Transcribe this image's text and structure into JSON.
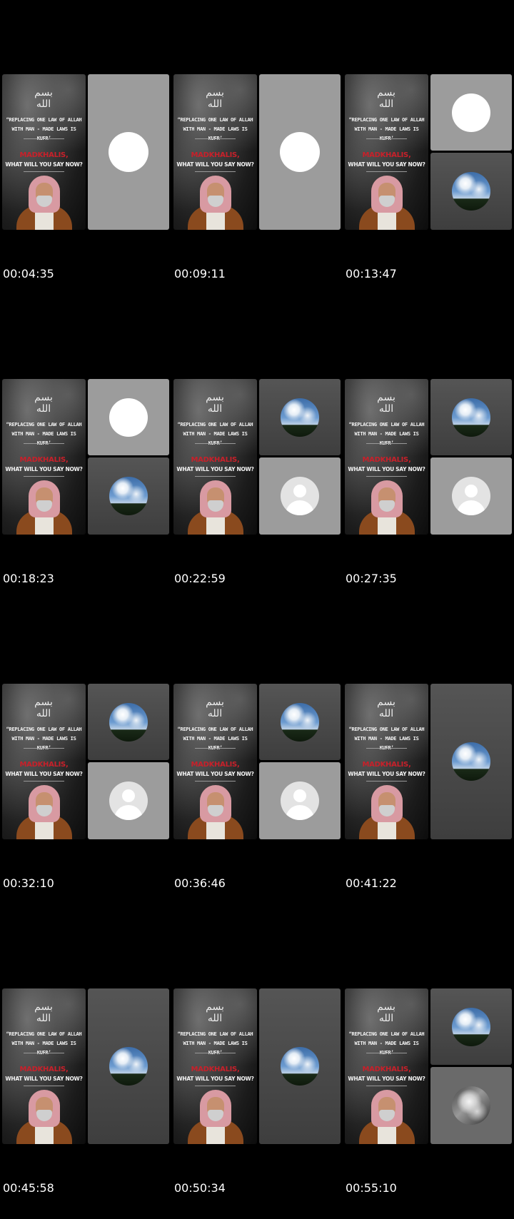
{
  "poster": {
    "calligraphy": "بسم الله",
    "quote_line1": "“REPLACING ONE LAW OF ALLAH",
    "quote_line2": "WITH MAN - MADE LAWS IS KUFR’",
    "headline": "MADKHALIS,",
    "subheadline": "WHAT WILL YOU SAY NOW?"
  },
  "frames": [
    {
      "timestamp": "00:04:35",
      "layout": "single",
      "panels": [
        "blank-white"
      ]
    },
    {
      "timestamp": "00:09:11",
      "layout": "single",
      "panels": [
        "blank-white"
      ]
    },
    {
      "timestamp": "00:13:47",
      "layout": "split",
      "panels": [
        "blank-white",
        "sky"
      ]
    },
    {
      "timestamp": "00:18:23",
      "layout": "split",
      "panels": [
        "blank-white",
        "sky"
      ]
    },
    {
      "timestamp": "00:22:59",
      "layout": "split",
      "panels": [
        "sky",
        "default-avatar"
      ]
    },
    {
      "timestamp": "00:27:35",
      "layout": "split",
      "panels": [
        "sky",
        "default-avatar"
      ]
    },
    {
      "timestamp": "00:32:10",
      "layout": "split",
      "panels": [
        "sky",
        "default-avatar"
      ]
    },
    {
      "timestamp": "00:36:46",
      "layout": "split",
      "panels": [
        "sky",
        "default-avatar"
      ]
    },
    {
      "timestamp": "00:41:22",
      "layout": "single",
      "panels": [
        "sky"
      ]
    },
    {
      "timestamp": "00:45:58",
      "layout": "single",
      "panels": [
        "sky"
      ]
    },
    {
      "timestamp": "00:50:34",
      "layout": "single",
      "panels": [
        "sky"
      ]
    },
    {
      "timestamp": "00:55:10",
      "layout": "split",
      "panels": [
        "sky",
        "photo"
      ]
    }
  ]
}
